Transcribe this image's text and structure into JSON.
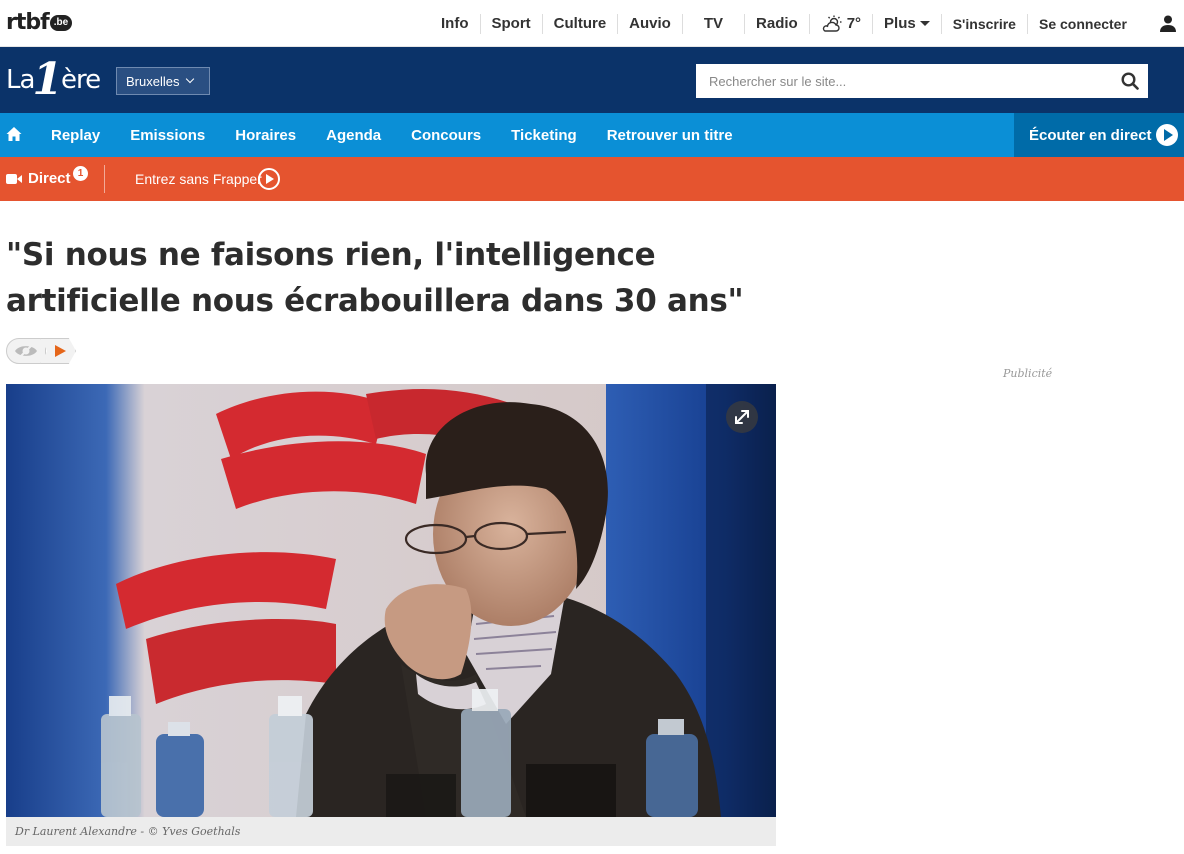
{
  "topbar": {
    "logo_text": "rtbf",
    "logo_badge": ".be",
    "nav": [
      "Info",
      "Sport",
      "Culture",
      "Auvio",
      "TV",
      "Radio"
    ],
    "weather_temp": "7°",
    "more_label": "Plus",
    "signup_label": "S'inscrire",
    "login_label": "Se connecter"
  },
  "brand": {
    "logo_la": "La",
    "logo_one": "1",
    "logo_ere": "ère",
    "region": "Bruxelles",
    "search_placeholder": "Rechercher sur le site..."
  },
  "mainnav": {
    "links": [
      "Replay",
      "Emissions",
      "Horaires",
      "Agenda",
      "Concours",
      "Ticketing",
      "Retrouver un titre"
    ],
    "listen_label": "Écouter en direct"
  },
  "directbar": {
    "label": "Direct",
    "badge": "1",
    "show": "Entrez sans Frapper"
  },
  "article": {
    "headline": "\"Si nous ne faisons rien, l'intelligence artificielle nous écrabouillera dans 30 ans\"",
    "caption": "Dr Laurent Alexandre - © Yves Goethals"
  },
  "sidebar": {
    "ad_label": "Publicité"
  },
  "colors": {
    "brand_navy": "#0b3369",
    "nav_blue": "#0b8fd6",
    "listen_blue": "#006ba8",
    "direct_orange": "#e5542f"
  }
}
